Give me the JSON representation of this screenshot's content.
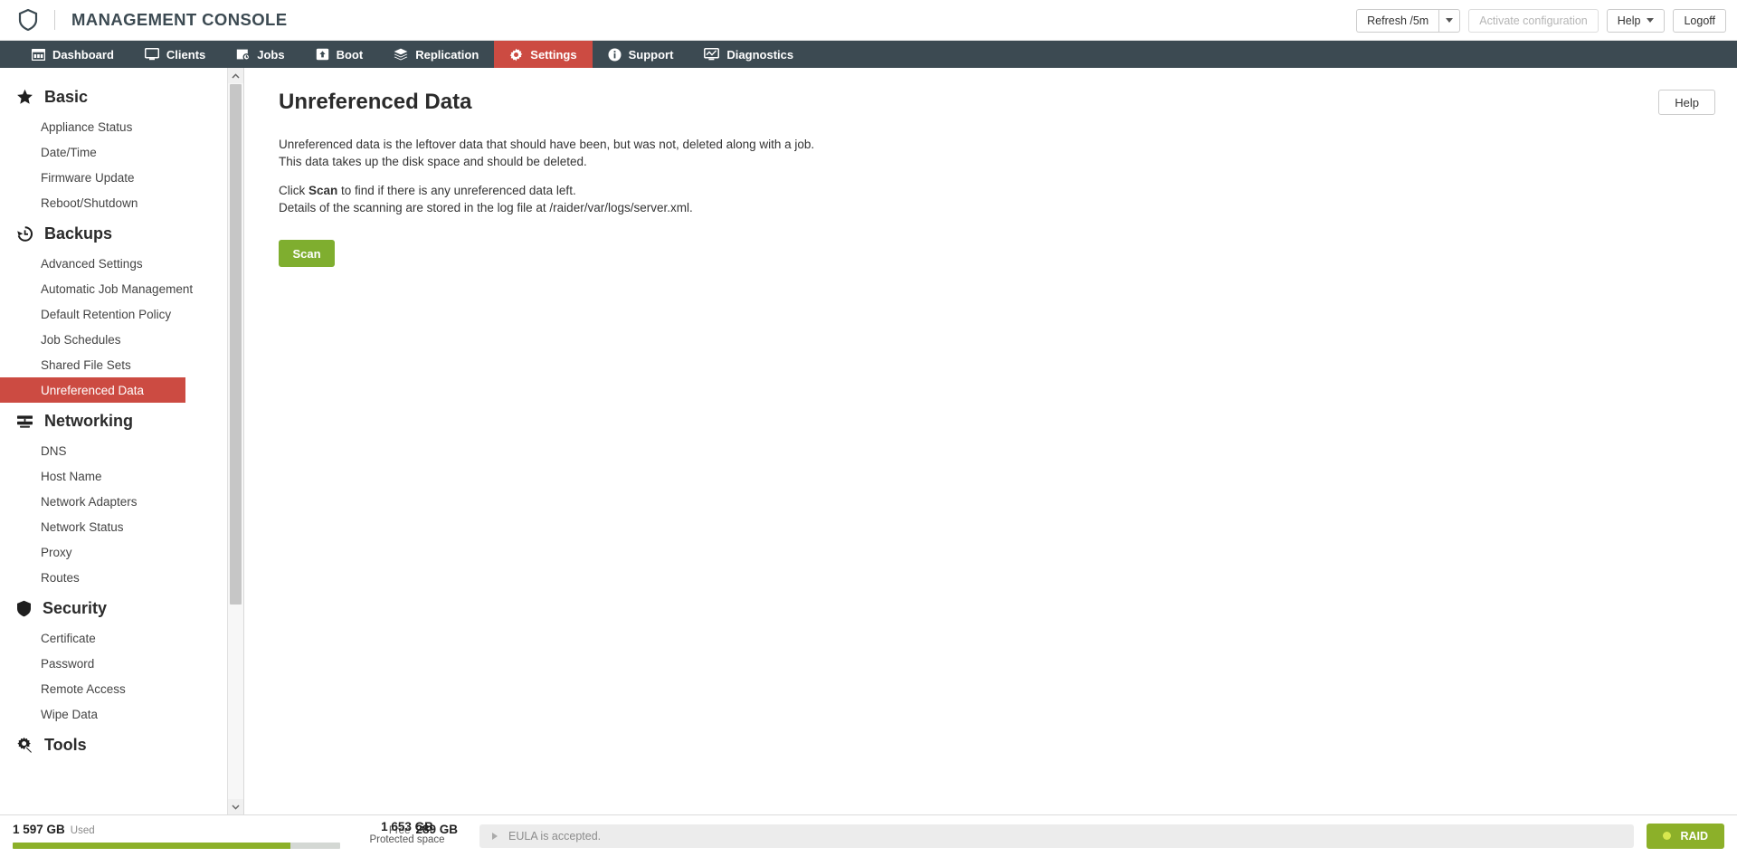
{
  "header": {
    "logo_icon": "shield-logo-icon",
    "title": "MANAGEMENT CONSOLE",
    "refresh_label": "Refresh /5m",
    "refresh_caret_icon": "chevron-down-icon",
    "activate_label": "Activate configuration",
    "help_label": "Help",
    "help_caret_icon": "chevron-down-icon",
    "logoff_label": "Logoff"
  },
  "nav": {
    "items": [
      {
        "label": "Dashboard",
        "icon": "dashboard-icon",
        "active": false
      },
      {
        "label": "Clients",
        "icon": "monitor-icon",
        "active": false
      },
      {
        "label": "Jobs",
        "icon": "jobs-clock-icon",
        "active": false
      },
      {
        "label": "Boot",
        "icon": "boot-upload-icon",
        "active": false
      },
      {
        "label": "Replication",
        "icon": "layers-icon",
        "active": false
      },
      {
        "label": "Settings",
        "icon": "gear-icon",
        "active": true
      },
      {
        "label": "Support",
        "icon": "info-icon",
        "active": false
      },
      {
        "label": "Diagnostics",
        "icon": "monitor-chart-icon",
        "active": false
      }
    ]
  },
  "sidebar": {
    "sections": [
      {
        "title": "Basic",
        "icon": "star-icon",
        "items": [
          {
            "label": "Appliance Status",
            "selected": false
          },
          {
            "label": "Date/Time",
            "selected": false
          },
          {
            "label": "Firmware Update",
            "selected": false
          },
          {
            "label": "Reboot/Shutdown",
            "selected": false
          }
        ]
      },
      {
        "title": "Backups",
        "icon": "history-clock-icon",
        "items": [
          {
            "label": "Advanced Settings",
            "selected": false
          },
          {
            "label": "Automatic Job Management",
            "selected": false
          },
          {
            "label": "Default Retention Policy",
            "selected": false
          },
          {
            "label": "Job Schedules",
            "selected": false
          },
          {
            "label": "Shared File Sets",
            "selected": false
          },
          {
            "label": "Unreferenced Data",
            "selected": true
          }
        ]
      },
      {
        "title": "Networking",
        "icon": "server-rack-icon",
        "items": [
          {
            "label": "DNS",
            "selected": false
          },
          {
            "label": "Host Name",
            "selected": false
          },
          {
            "label": "Network Adapters",
            "selected": false
          },
          {
            "label": "Network Status",
            "selected": false
          },
          {
            "label": "Proxy",
            "selected": false
          },
          {
            "label": "Routes",
            "selected": false
          }
        ]
      },
      {
        "title": "Security",
        "icon": "shield-icon",
        "items": [
          {
            "label": "Certificate",
            "selected": false
          },
          {
            "label": "Password",
            "selected": false
          },
          {
            "label": "Remote Access",
            "selected": false
          },
          {
            "label": "Wipe Data",
            "selected": false
          }
        ]
      },
      {
        "title": "Tools",
        "icon": "gear-wrench-icon",
        "items": []
      }
    ],
    "scrollbar": {
      "up_icon": "chevron-up-icon",
      "down_icon": "chevron-down-icon"
    }
  },
  "main": {
    "title": "Unreferenced Data",
    "help_label": "Help",
    "paragraph1_line1": "Unreferenced data is the leftover data that should have been, but was not, deleted along with a job.",
    "paragraph1_line2": "This data takes up the disk space and should be deleted.",
    "paragraph2_prefix": "Click ",
    "paragraph2_bold": "Scan",
    "paragraph2_suffix": " to find if there is any unreferenced data left.",
    "paragraph2_line2": "Details of the scanning are stored in the log file at /raider/var/logs/server.xml.",
    "scan_label": "Scan"
  },
  "footer": {
    "used_value": "1 597 GB",
    "used_label": "Used",
    "free_label": "Free",
    "free_value": "289 GB",
    "protected_value": "1 653 GB",
    "protected_label": "Protected space",
    "usage_percent": 84.7,
    "eula_text": "EULA is accepted.",
    "eula_chevron_icon": "chevron-right-icon",
    "raid_label": "RAID",
    "raid_status_icon": "status-dot-icon"
  },
  "colors": {
    "accent_red": "#cc4b42",
    "nav_dark": "#3c4a52",
    "green": "#8cb029",
    "scan_green": "#7fae2f"
  }
}
